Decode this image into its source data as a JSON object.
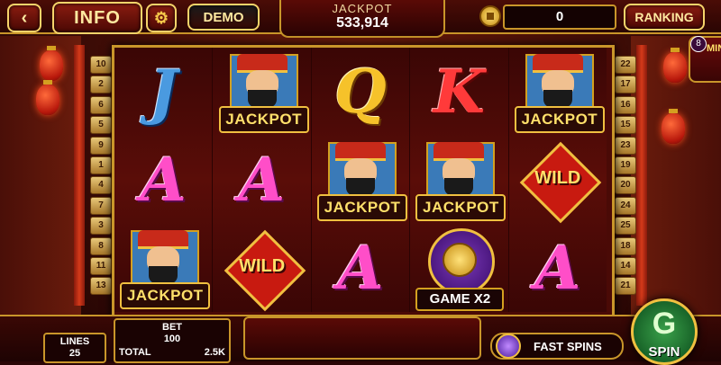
{
  "top": {
    "info_label": "INFO",
    "demo_label": "DEMO",
    "jackpot_label": "JACKPOT",
    "jackpot_value": "533,914",
    "balance": "0",
    "ranking_label": "RANKING"
  },
  "mini_game": {
    "badge": "8",
    "label": "MINI GAME"
  },
  "lines_left": [
    "10",
    "2",
    "6",
    "5",
    "9",
    "1",
    "4",
    "7",
    "3",
    "8",
    "11",
    "13"
  ],
  "lines_right": [
    "22",
    "17",
    "16",
    "15",
    "23",
    "19",
    "20",
    "24",
    "25",
    "18",
    "14",
    "21"
  ],
  "reels": [
    [
      {
        "type": "letter",
        "value": "J",
        "cls": "let-J"
      },
      {
        "type": "letter",
        "value": "A",
        "cls": "let-A"
      },
      {
        "type": "jackpot",
        "label": "JACKPOT"
      }
    ],
    [
      {
        "type": "jackpot",
        "label": "JACKPOT"
      },
      {
        "type": "letter",
        "value": "A",
        "cls": "let-A"
      },
      {
        "type": "wild",
        "label": "WILD"
      }
    ],
    [
      {
        "type": "letter",
        "value": "Q",
        "cls": "let-Q"
      },
      {
        "type": "jackpot",
        "label": "JACKPOT"
      },
      {
        "type": "letter",
        "value": "A",
        "cls": "let-A"
      }
    ],
    [
      {
        "type": "letter",
        "value": "K",
        "cls": "let-K"
      },
      {
        "type": "jackpot",
        "label": "JACKPOT"
      },
      {
        "type": "game",
        "label": "GAME X2"
      }
    ],
    [
      {
        "type": "jackpot",
        "label": "JACKPOT"
      },
      {
        "type": "wild",
        "label": "WILD"
      },
      {
        "type": "letter",
        "value": "A",
        "cls": "let-A"
      }
    ]
  ],
  "bottom": {
    "lines_label": "LINES",
    "lines_value": "25",
    "bet_label": "BET",
    "bet_value": "100",
    "total_label": "TOTAL",
    "total_value": "2.5K",
    "fast_spins_label": "FAST SPINS",
    "spin_label": "SPIN"
  }
}
